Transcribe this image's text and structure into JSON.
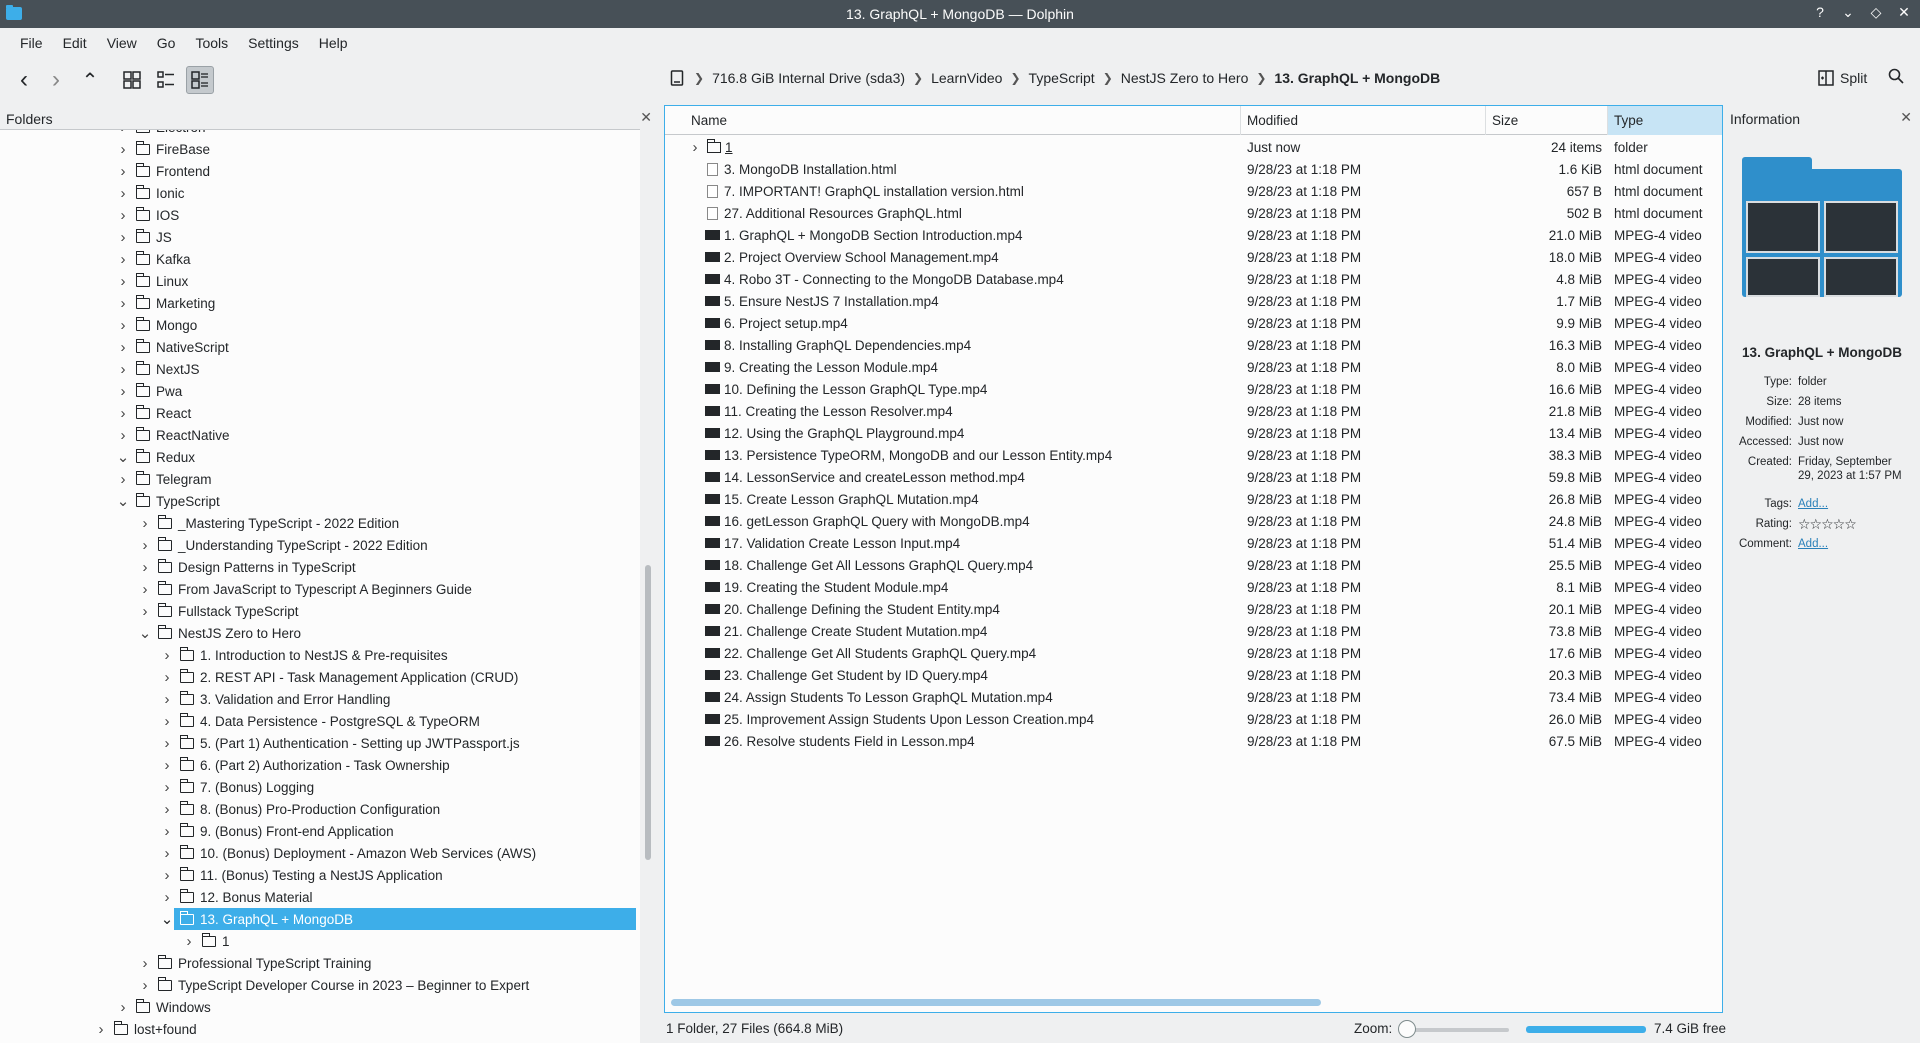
{
  "window": {
    "title": "13. GraphQL + MongoDB — Dolphin",
    "buttons": [
      "?",
      "⌄",
      "◇",
      "✕"
    ]
  },
  "menu": [
    "File",
    "Edit",
    "View",
    "Go",
    "Tools",
    "Settings",
    "Help"
  ],
  "toolbar": {
    "back": "‹",
    "forward": "›",
    "up": "⌃",
    "split_label": "Split"
  },
  "breadcrumb": {
    "items": [
      "716.8 GiB Internal Drive (sda3)",
      "LearnVideo",
      "TypeScript",
      "NestJS Zero to Hero"
    ],
    "current": "13. GraphQL + MongoDB"
  },
  "folders_panel": {
    "title": "Folders",
    "close": "✕",
    "items": [
      {
        "label": "Electron",
        "depth": 0,
        "expanded": false
      },
      {
        "label": "FireBase",
        "depth": 0,
        "expanded": false
      },
      {
        "label": "Frontend",
        "depth": 0,
        "expanded": false
      },
      {
        "label": "Ionic",
        "depth": 0,
        "expanded": false
      },
      {
        "label": "IOS",
        "depth": 0,
        "expanded": false
      },
      {
        "label": "JS",
        "depth": 0,
        "expanded": false
      },
      {
        "label": "Kafka",
        "depth": 0,
        "expanded": false
      },
      {
        "label": "Linux",
        "depth": 0,
        "expanded": false
      },
      {
        "label": "Marketing",
        "depth": 0,
        "expanded": false
      },
      {
        "label": "Mongo",
        "depth": 0,
        "expanded": false
      },
      {
        "label": "NativeScript",
        "depth": 0,
        "expanded": false
      },
      {
        "label": "NextJS",
        "depth": 0,
        "expanded": false
      },
      {
        "label": "Pwa",
        "depth": 0,
        "expanded": false
      },
      {
        "label": "React",
        "depth": 0,
        "expanded": false
      },
      {
        "label": "ReactNative",
        "depth": 0,
        "expanded": false
      },
      {
        "label": "Redux",
        "depth": 0,
        "expanded": true
      },
      {
        "label": "Telegram",
        "depth": 0,
        "expanded": false
      },
      {
        "label": "TypeScript",
        "depth": 0,
        "expanded": true
      },
      {
        "label": "_Mastering TypeScript - 2022 Edition",
        "depth": 1,
        "expanded": false
      },
      {
        "label": "_Understanding TypeScript - 2022 Edition",
        "depth": 1,
        "expanded": false
      },
      {
        "label": "Design Patterns in TypeScript",
        "depth": 1,
        "expanded": false
      },
      {
        "label": "From JavaScript to Typescript A Beginners Guide",
        "depth": 1,
        "expanded": false
      },
      {
        "label": "Fullstack TypeScript",
        "depth": 1,
        "expanded": false
      },
      {
        "label": "NestJS Zero to Hero",
        "depth": 1,
        "expanded": true
      },
      {
        "label": "1. Introduction to NestJS & Pre-requisites",
        "depth": 2,
        "expanded": false
      },
      {
        "label": "2. REST API - Task Management Application (CRUD)",
        "depth": 2,
        "expanded": false
      },
      {
        "label": "3. Validation and Error Handling",
        "depth": 2,
        "expanded": false
      },
      {
        "label": "4. Data Persistence - PostgreSQL & TypeORM",
        "depth": 2,
        "expanded": false
      },
      {
        "label": "5. (Part 1) Authentication - Setting up JWTPassport.js",
        "depth": 2,
        "expanded": false
      },
      {
        "label": "6. (Part 2) Authorization - Task Ownership",
        "depth": 2,
        "expanded": false
      },
      {
        "label": "7. (Bonus) Logging",
        "depth": 2,
        "expanded": false
      },
      {
        "label": "8. (Bonus) Pro-Production Configuration",
        "depth": 2,
        "expanded": false
      },
      {
        "label": "9. (Bonus) Front-end Application",
        "depth": 2,
        "expanded": false
      },
      {
        "label": "10. (Bonus) Deployment - Amazon Web Services (AWS)",
        "depth": 2,
        "expanded": false
      },
      {
        "label": "11. (Bonus) Testing a NestJS Application",
        "depth": 2,
        "expanded": false
      },
      {
        "label": "12. Bonus Material",
        "depth": 2,
        "expanded": false
      },
      {
        "label": "13. GraphQL + MongoDB",
        "depth": 2,
        "expanded": true,
        "selected": true
      },
      {
        "label": "1",
        "depth": 3,
        "expanded": false
      },
      {
        "label": "Professional TypeScript Training",
        "depth": 1,
        "expanded": false
      },
      {
        "label": "TypeScript Developer Course in 2023 – Beginner to Expert",
        "depth": 1,
        "expanded": false
      },
      {
        "label": "Windows",
        "depth": 0,
        "expanded": false
      },
      {
        "label": "lost+found",
        "depth": -1,
        "expanded": false
      }
    ]
  },
  "file_view": {
    "columns": {
      "name": "Name",
      "modified": "Modified",
      "size": "Size",
      "type": "Type"
    },
    "rows": [
      {
        "name": "1",
        "modified": "Just now",
        "size": "24 items",
        "type": "folder",
        "kind": "folder"
      },
      {
        "name": "3. MongoDB Installation.html",
        "modified": "9/28/23 at 1:18 PM",
        "size": "1.6 KiB",
        "type": "html document",
        "kind": "doc"
      },
      {
        "name": "7. IMPORTANT! GraphQL installation version.html",
        "modified": "9/28/23 at 1:18 PM",
        "size": "657 B",
        "type": "html document",
        "kind": "doc"
      },
      {
        "name": "27. Additional Resources GraphQL.html",
        "modified": "9/28/23 at 1:18 PM",
        "size": "502 B",
        "type": "html document",
        "kind": "doc"
      },
      {
        "name": "1. GraphQL + MongoDB Section Introduction.mp4",
        "modified": "9/28/23 at 1:18 PM",
        "size": "21.0 MiB",
        "type": "MPEG-4 video",
        "kind": "video"
      },
      {
        "name": "2. Project Overview School Management.mp4",
        "modified": "9/28/23 at 1:18 PM",
        "size": "18.0 MiB",
        "type": "MPEG-4 video",
        "kind": "video"
      },
      {
        "name": "4. Robo 3T - Connecting to the MongoDB Database.mp4",
        "modified": "9/28/23 at 1:18 PM",
        "size": "4.8 MiB",
        "type": "MPEG-4 video",
        "kind": "video"
      },
      {
        "name": "5. Ensure NestJS 7 Installation.mp4",
        "modified": "9/28/23 at 1:18 PM",
        "size": "1.7 MiB",
        "type": "MPEG-4 video",
        "kind": "video"
      },
      {
        "name": "6. Project setup.mp4",
        "modified": "9/28/23 at 1:18 PM",
        "size": "9.9 MiB",
        "type": "MPEG-4 video",
        "kind": "video"
      },
      {
        "name": "8. Installing GraphQL Dependencies.mp4",
        "modified": "9/28/23 at 1:18 PM",
        "size": "16.3 MiB",
        "type": "MPEG-4 video",
        "kind": "video"
      },
      {
        "name": "9. Creating the Lesson Module.mp4",
        "modified": "9/28/23 at 1:18 PM",
        "size": "8.0 MiB",
        "type": "MPEG-4 video",
        "kind": "video"
      },
      {
        "name": "10. Defining the Lesson GraphQL Type.mp4",
        "modified": "9/28/23 at 1:18 PM",
        "size": "16.6 MiB",
        "type": "MPEG-4 video",
        "kind": "video"
      },
      {
        "name": "11. Creating the Lesson Resolver.mp4",
        "modified": "9/28/23 at 1:18 PM",
        "size": "21.8 MiB",
        "type": "MPEG-4 video",
        "kind": "video"
      },
      {
        "name": "12. Using the GraphQL Playground.mp4",
        "modified": "9/28/23 at 1:18 PM",
        "size": "13.4 MiB",
        "type": "MPEG-4 video",
        "kind": "video"
      },
      {
        "name": "13. Persistence TypeORM, MongoDB and our Lesson Entity.mp4",
        "modified": "9/28/23 at 1:18 PM",
        "size": "38.3 MiB",
        "type": "MPEG-4 video",
        "kind": "video"
      },
      {
        "name": "14. LessonService and createLesson method.mp4",
        "modified": "9/28/23 at 1:18 PM",
        "size": "59.8 MiB",
        "type": "MPEG-4 video",
        "kind": "video"
      },
      {
        "name": "15. Create Lesson GraphQL Mutation.mp4",
        "modified": "9/28/23 at 1:18 PM",
        "size": "26.8 MiB",
        "type": "MPEG-4 video",
        "kind": "video"
      },
      {
        "name": "16. getLesson GraphQL Query with MongoDB.mp4",
        "modified": "9/28/23 at 1:18 PM",
        "size": "24.8 MiB",
        "type": "MPEG-4 video",
        "kind": "video"
      },
      {
        "name": "17. Validation Create Lesson Input.mp4",
        "modified": "9/28/23 at 1:18 PM",
        "size": "51.4 MiB",
        "type": "MPEG-4 video",
        "kind": "video"
      },
      {
        "name": "18. Challenge Get All Lessons GraphQL Query.mp4",
        "modified": "9/28/23 at 1:18 PM",
        "size": "25.5 MiB",
        "type": "MPEG-4 video",
        "kind": "video"
      },
      {
        "name": "19. Creating the Student Module.mp4",
        "modified": "9/28/23 at 1:18 PM",
        "size": "8.1 MiB",
        "type": "MPEG-4 video",
        "kind": "video"
      },
      {
        "name": "20. Challenge Defining the Student Entity.mp4",
        "modified": "9/28/23 at 1:18 PM",
        "size": "20.1 MiB",
        "type": "MPEG-4 video",
        "kind": "video"
      },
      {
        "name": "21. Challenge Create Student Mutation.mp4",
        "modified": "9/28/23 at 1:18 PM",
        "size": "73.8 MiB",
        "type": "MPEG-4 video",
        "kind": "video"
      },
      {
        "name": "22. Challenge Get All Students GraphQL Query.mp4",
        "modified": "9/28/23 at 1:18 PM",
        "size": "17.6 MiB",
        "type": "MPEG-4 video",
        "kind": "video"
      },
      {
        "name": "23. Challenge Get Student by ID Query.mp4",
        "modified": "9/28/23 at 1:18 PM",
        "size": "20.3 MiB",
        "type": "MPEG-4 video",
        "kind": "video"
      },
      {
        "name": "24. Assign Students To Lesson GraphQL Mutation.mp4",
        "modified": "9/28/23 at 1:18 PM",
        "size": "73.4 MiB",
        "type": "MPEG-4 video",
        "kind": "video"
      },
      {
        "name": "25. Improvement Assign Students Upon Lesson Creation.mp4",
        "modified": "9/28/23 at 1:18 PM",
        "size": "26.0 MiB",
        "type": "MPEG-4 video",
        "kind": "video"
      },
      {
        "name": "26. Resolve students Field in Lesson.mp4",
        "modified": "9/28/23 at 1:18 PM",
        "size": "67.5 MiB",
        "type": "MPEG-4 video",
        "kind": "video"
      }
    ]
  },
  "info_panel": {
    "title": "Information",
    "close": "✕",
    "name": "13. GraphQL + MongoDB",
    "fields": [
      {
        "k": "Type:",
        "v": "folder"
      },
      {
        "k": "Size:",
        "v": "28 items"
      },
      {
        "k": "Modified:",
        "v": "Just now"
      },
      {
        "k": "Accessed:",
        "v": "Just now"
      },
      {
        "k": "Created:",
        "v": "Friday, September 29, 2023 at 1:57 PM"
      },
      {
        "k": "Tags:",
        "v": "Add...",
        "link": true
      },
      {
        "k": "Rating:",
        "v": "☆☆☆☆☆"
      },
      {
        "k": "Comment:",
        "v": "Add...",
        "link": true
      }
    ]
  },
  "statusbar": {
    "summary": "1 Folder, 27 Files (664.8 MiB)",
    "zoom_label": "Zoom:",
    "free": "7.4 GiB free"
  },
  "colors": {
    "accent": "#3daee9",
    "titlebar": "#475057",
    "link": "#2980b9"
  }
}
